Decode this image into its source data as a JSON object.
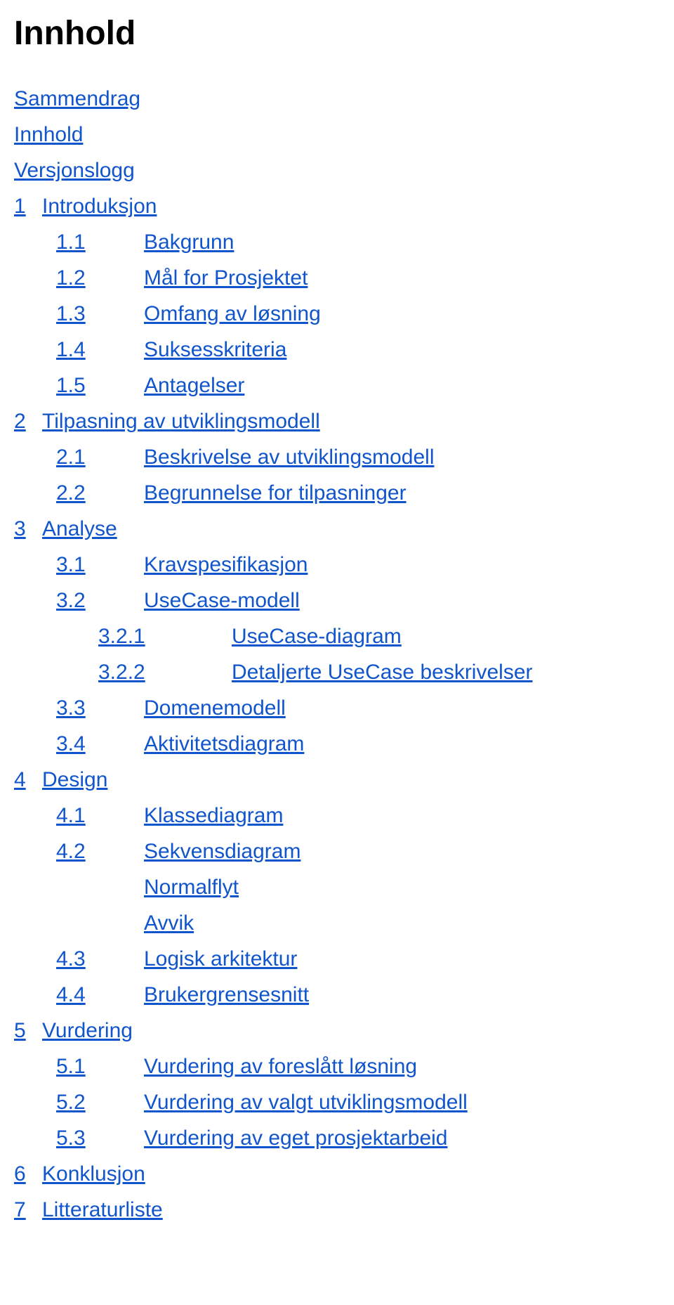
{
  "title": "Innhold",
  "toc": {
    "prelim": [
      {
        "label": "Sammendrag"
      },
      {
        "label": "Innhold"
      },
      {
        "label": "Versjonslogg"
      }
    ],
    "s1": {
      "num": "1",
      "label": "Introduksjon",
      "children": [
        {
          "num": "1.1",
          "label": "Bakgrunn"
        },
        {
          "num": "1.2",
          "label": "Mål for Prosjektet"
        },
        {
          "num": "1.3",
          "label": "Omfang av løsning"
        },
        {
          "num": "1.4",
          "label": "Suksesskriteria"
        },
        {
          "num": "1.5",
          "label": "Antagelser"
        }
      ]
    },
    "s2": {
      "num": "2",
      "label": "Tilpasning av utviklingsmodell",
      "children": [
        {
          "num": "2.1",
          "label": "Beskrivelse av utviklingsmodell"
        },
        {
          "num": "2.2",
          "label": "Begrunnelse for tilpasninger"
        }
      ]
    },
    "s3": {
      "num": "3",
      "label": "Analyse",
      "children": [
        {
          "num": "3.1",
          "label": "Kravspesifikasjon"
        },
        {
          "num": "3.2",
          "label": "UseCase-modell",
          "children": [
            {
              "num": "3.2.1",
              "label": "UseCase-diagram"
            },
            {
              "num": "3.2.2",
              "label": "Detaljerte UseCase beskrivelser"
            }
          ]
        },
        {
          "num": "3.3",
          "label": "Domenemodell"
        },
        {
          "num": "3.4",
          "label": "Aktivitetsdiagram"
        }
      ]
    },
    "s4": {
      "num": "4",
      "label": "Design",
      "children": [
        {
          "num": "4.1",
          "label": "Klassediagram"
        },
        {
          "num": "4.2",
          "label": "Sekvensdiagram",
          "extras": [
            {
              "label": "Normalflyt"
            },
            {
              "label": "Avvik"
            }
          ]
        },
        {
          "num": "4.3",
          "label": "Logisk arkitektur"
        },
        {
          "num": "4.4",
          "label": "Brukergrensesnitt"
        }
      ]
    },
    "s5": {
      "num": "5",
      "label": "Vurdering",
      "children": [
        {
          "num": "5.1",
          "label": "Vurdering av foreslått løsning"
        },
        {
          "num": "5.2",
          "label": "Vurdering av valgt utviklingsmodell"
        },
        {
          "num": "5.3",
          "label": "Vurdering av eget prosjektarbeid"
        }
      ]
    },
    "s6": {
      "num": "6",
      "label": "Konklusjon"
    },
    "s7": {
      "num": "7",
      "label": "Litteraturliste"
    }
  }
}
